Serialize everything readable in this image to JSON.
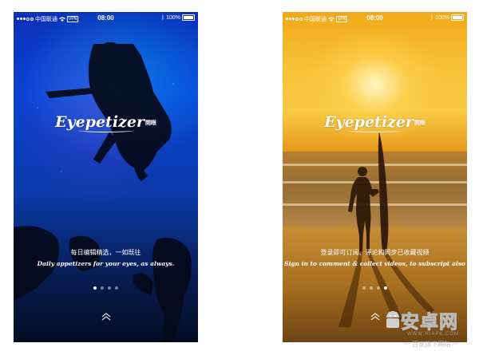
{
  "status_bar": {
    "carrier": "中国联通",
    "vpn": "VPN",
    "time": "08:00",
    "battery": "100%"
  },
  "screens": [
    {
      "logo_main": "Eyepetizer",
      "logo_sub": "開眼",
      "caption_cn": "每日编辑精选，一如既往",
      "caption_en": "Daily appetizers for your eyes, as always.",
      "active_page": 1,
      "page_count": 4
    },
    {
      "logo_main": "Eyepetizer",
      "logo_sub": "開眼",
      "caption_cn": "登录即可订阅、评论和同步已收藏视频",
      "caption_en": "Sign in to comment & collect videos, to subscript also",
      "active_page": 4,
      "page_count": 4
    }
  ],
  "icons": {
    "swipe_up": "double-chevron-up-icon",
    "wifi": "wifi-icon",
    "bluetooth": "bluetooth-icon",
    "battery": "battery-icon"
  },
  "watermark": {
    "title": "安卓网",
    "url": "WWW.HIAPK.COM",
    "slogan": "一 百家旗下网站 一"
  },
  "colors": {
    "left_bg": "#0b43d6",
    "right_bg": "#f7c33a",
    "text": "#ffffff"
  }
}
